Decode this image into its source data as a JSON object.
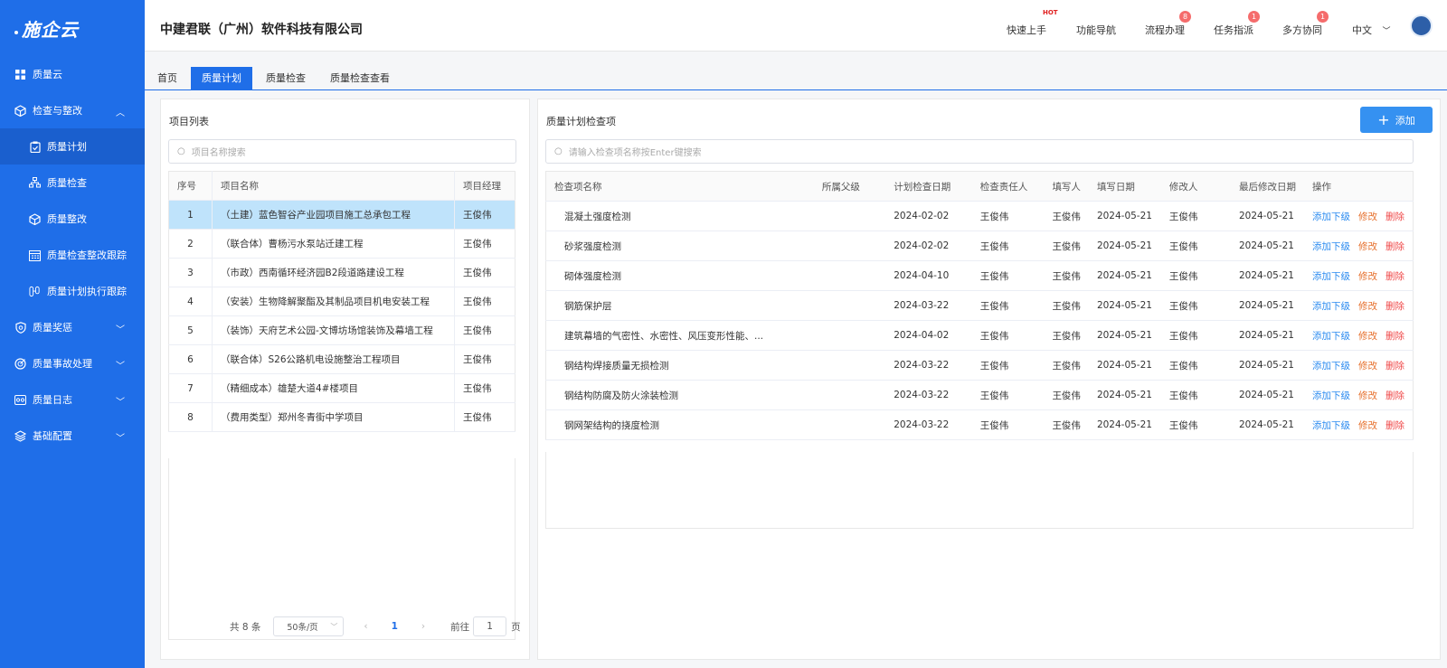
{
  "logo": {
    "text": "施企云"
  },
  "sidebar": {
    "items": [
      {
        "label": "质量云"
      },
      {
        "label": "检查与整改"
      },
      {
        "label": "质量计划"
      },
      {
        "label": "质量检查"
      },
      {
        "label": "质量整改"
      },
      {
        "label": "质量检查整改跟踪"
      },
      {
        "label": "质量计划执行跟踪"
      },
      {
        "label": "质量奖惩"
      },
      {
        "label": "质量事故处理"
      },
      {
        "label": "质量日志"
      },
      {
        "label": "基础配置"
      }
    ]
  },
  "header": {
    "company": "中建君联（广州）软件科技有限公司",
    "nav": [
      {
        "label": "快速上手",
        "badge": "HOT"
      },
      {
        "label": "功能导航",
        "badge": ""
      },
      {
        "label": "流程办理",
        "badge": "8"
      },
      {
        "label": "任务指派",
        "badge": "1"
      },
      {
        "label": "多方协同",
        "badge": "1"
      }
    ],
    "lang": "中文"
  },
  "tabs": [
    {
      "label": "首页"
    },
    {
      "label": "质量计划"
    },
    {
      "label": "质量检查"
    },
    {
      "label": "质量检查查看"
    }
  ],
  "project_panel": {
    "title": "项目列表",
    "search_placeholder": "项目名称搜索",
    "columns": [
      "序号",
      "项目名称",
      "项目经理"
    ],
    "rows": [
      [
        "1",
        "（土建）蓝色智谷产业园项目施工总承包工程",
        "王俊伟"
      ],
      [
        "2",
        "（联合体）曹杨污水泵站迁建工程",
        "王俊伟"
      ],
      [
        "3",
        "（市政）西南循环经济园B2段道路建设工程",
        "王俊伟"
      ],
      [
        "4",
        "（安装）生物降解聚酯及其制品项目机电安装工程",
        "王俊伟"
      ],
      [
        "5",
        "（装饰）天府艺术公园-文博坊场馆装饰及幕墙工程",
        "王俊伟"
      ],
      [
        "6",
        "（联合体）S26公路机电设施整治工程项目",
        "王俊伟"
      ],
      [
        "7",
        "（精细成本）雄楚大道4#楼项目",
        "王俊伟"
      ],
      [
        "8",
        "（费用类型）郑州冬青街中学项目",
        "王俊伟"
      ]
    ],
    "pager": {
      "total": "共 8 条",
      "page_size": "50条/页",
      "current": "1",
      "goto_label": "前往",
      "goto_value": "1",
      "page_unit": "页"
    }
  },
  "check_panel": {
    "title": "质量计划检查项",
    "add_label": "添加",
    "search_placeholder": "请输入检查项名称按Enter键搜索",
    "columns": [
      "检查项名称",
      "所属父级",
      "计划检查日期",
      "检查责任人",
      "填写人",
      "填写日期",
      "修改人",
      "最后修改日期",
      "操作"
    ],
    "action_labels": [
      "添加下级",
      "修改",
      "删除"
    ],
    "rows": [
      [
        "混凝土强度检测",
        "",
        "2024-02-02",
        "王俊伟",
        "王俊伟",
        "2024-05-21",
        "王俊伟",
        "2024-05-21"
      ],
      [
        "砂浆强度检测",
        "",
        "2024-02-02",
        "王俊伟",
        "王俊伟",
        "2024-05-21",
        "王俊伟",
        "2024-05-21"
      ],
      [
        "砌体强度检测",
        "",
        "2024-04-10",
        "王俊伟",
        "王俊伟",
        "2024-05-21",
        "王俊伟",
        "2024-05-21"
      ],
      [
        "钢筋保护层",
        "",
        "2024-03-22",
        "王俊伟",
        "王俊伟",
        "2024-05-21",
        "王俊伟",
        "2024-05-21"
      ],
      [
        "建筑幕墙的气密性、水密性、风压变形性能、...",
        "",
        "2024-04-02",
        "王俊伟",
        "王俊伟",
        "2024-05-21",
        "王俊伟",
        "2024-05-21"
      ],
      [
        "钢结构焊接质量无损检测",
        "",
        "2024-03-22",
        "王俊伟",
        "王俊伟",
        "2024-05-21",
        "王俊伟",
        "2024-05-21"
      ],
      [
        "钢结构防腐及防火涂装检测",
        "",
        "2024-03-22",
        "王俊伟",
        "王俊伟",
        "2024-05-21",
        "王俊伟",
        "2024-05-21"
      ],
      [
        "钢网架结构的挠度检测",
        "",
        "2024-03-22",
        "王俊伟",
        "王俊伟",
        "2024-05-21",
        "王俊伟",
        "2024-05-21"
      ]
    ]
  }
}
